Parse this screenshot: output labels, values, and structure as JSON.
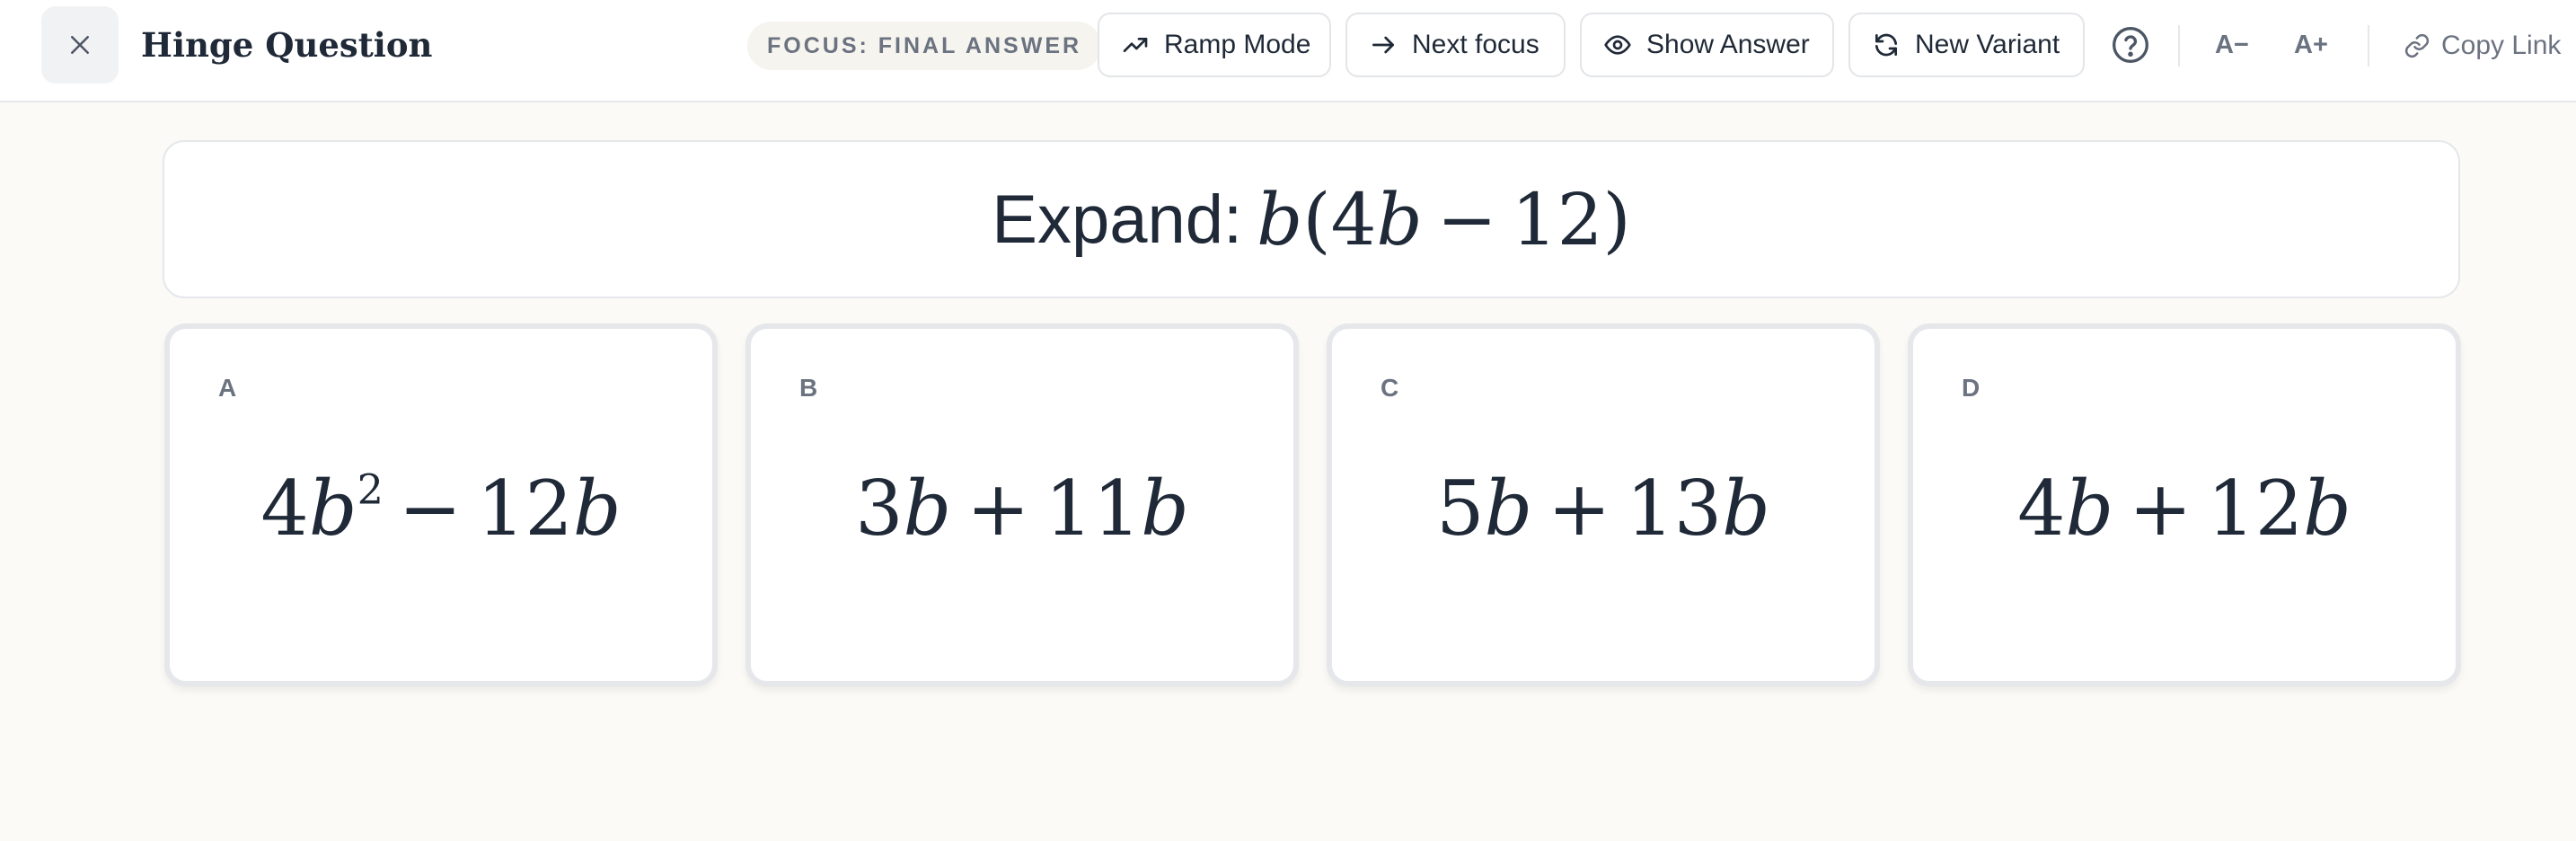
{
  "header": {
    "title": "Hinge Question",
    "focus_label": "FOCUS: FINAL ANSWER",
    "buttons": {
      "ramp_mode": "Ramp Mode",
      "next_focus": "Next focus",
      "show_answer": "Show Answer",
      "new_variant": "New Variant"
    },
    "font_decrease": "A−",
    "font_increase": "A+",
    "copy_link": "Copy Link"
  },
  "question": {
    "prompt": "Expand:",
    "expression": {
      "var": "b",
      "inner_coef": "4",
      "inner_var": "b",
      "operator": "−",
      "constant": "12"
    }
  },
  "options": [
    {
      "letter": "A",
      "t1": "4",
      "v1": "b",
      "exp1": "2",
      "op": "−",
      "t2": "12",
      "v2": "b"
    },
    {
      "letter": "B",
      "t1": "3",
      "v1": "b",
      "exp1": "",
      "op": "+",
      "t2": "11",
      "v2": "b"
    },
    {
      "letter": "C",
      "t1": "5",
      "v1": "b",
      "exp1": "",
      "op": "+",
      "t2": "13",
      "v2": "b"
    },
    {
      "letter": "D",
      "t1": "4",
      "v1": "b",
      "exp1": "",
      "op": "+",
      "t2": "12",
      "v2": "b"
    }
  ],
  "colors": {
    "page_background": "#fbfaf6",
    "text": "#1f2937",
    "muted": "#6b7280",
    "border": "#e5e7eb"
  },
  "icons": {
    "close": "close-icon",
    "ramp_mode": "trending-up-icon",
    "next_focus": "arrow-right-icon",
    "show_answer": "eye-icon",
    "new_variant": "refresh-icon",
    "help": "help-circle-icon",
    "copy_link": "link-icon"
  }
}
